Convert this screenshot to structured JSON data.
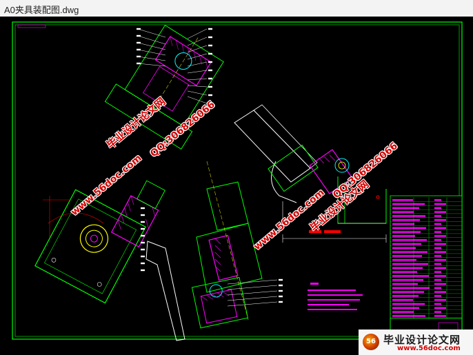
{
  "window": {
    "title": "A0夹具装配图.dwg"
  },
  "watermarks": {
    "left_site_name": "毕业设计论文网",
    "left_url": "www.56doc.com",
    "left_qq": "QQ:306826066",
    "right_site_name": "毕业设计论文网",
    "right_url": "www.56doc.com",
    "right_qq": "QQ:306826066"
  },
  "brand": {
    "logo_text": "56",
    "name": "毕业设计论文网",
    "url": "www.56doc.com"
  },
  "colors": {
    "background": "#000000",
    "frame": "#00ff00",
    "outline": "#00ff00",
    "hatch": "#ff00ff",
    "dimension": "#ffffff",
    "accent": "#00ffff",
    "watermark": "#d40000"
  }
}
